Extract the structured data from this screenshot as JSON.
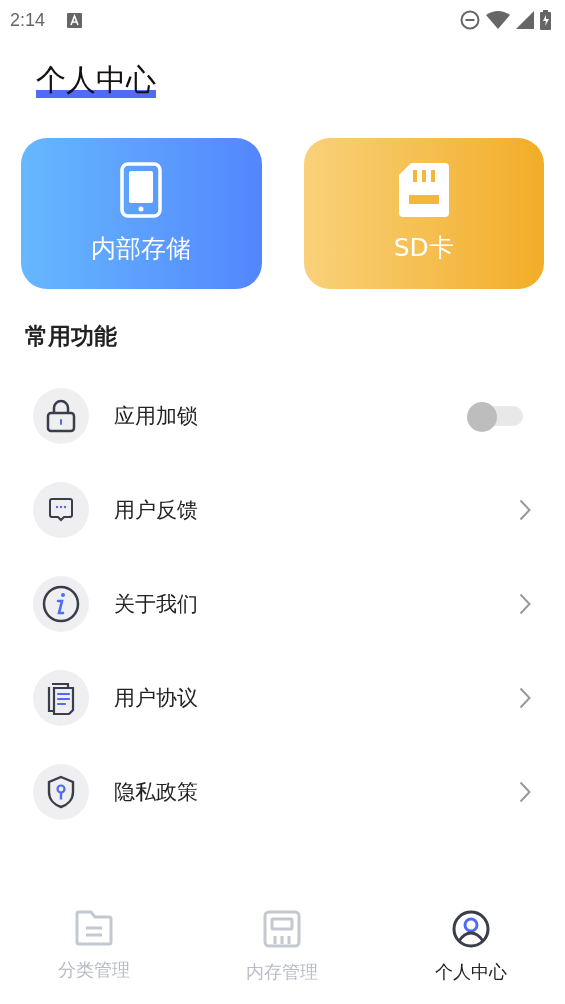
{
  "status_bar": {
    "time": "2:14"
  },
  "title": "个人中心",
  "storage_cards": [
    {
      "kind": "internal",
      "label": "内部存储"
    },
    {
      "kind": "sd",
      "label": "SD卡"
    }
  ],
  "section_title": "常用功能",
  "items": [
    {
      "kind": "toggle",
      "label": "应用加锁",
      "on": false
    },
    {
      "kind": "link",
      "label": "用户反馈"
    },
    {
      "kind": "link",
      "label": "关于我们"
    },
    {
      "kind": "link",
      "label": "用户协议"
    },
    {
      "kind": "link",
      "label": "隐私政策"
    }
  ],
  "tabs": [
    {
      "label": "分类管理",
      "selected": false
    },
    {
      "label": "内存管理",
      "selected": false
    },
    {
      "label": "个人中心",
      "selected": true
    }
  ]
}
